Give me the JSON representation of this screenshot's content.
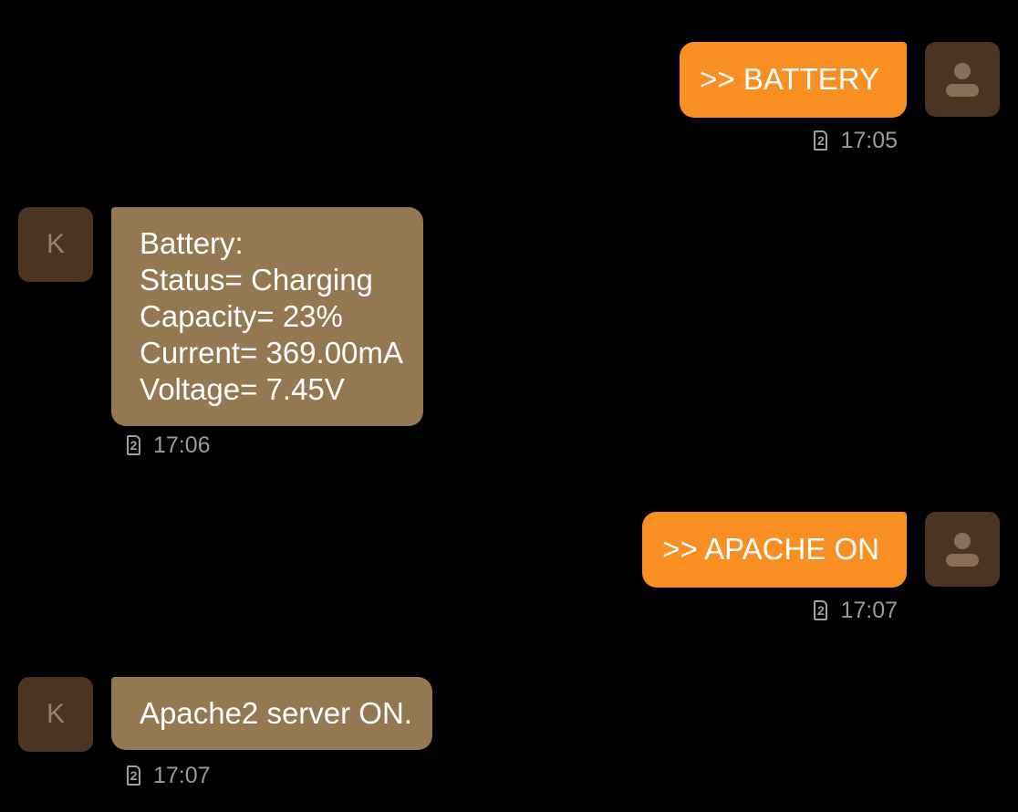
{
  "messages": [
    {
      "direction": "outgoing",
      "avatar_icon": "person-icon",
      "text": ">> BATTERY",
      "sim_slot": "2",
      "time": "17:05"
    },
    {
      "direction": "incoming",
      "avatar_letter": "K",
      "text": "Battery:\nStatus= Charging\nCapacity= 23%\nCurrent= 369.00mA\nVoltage= 7.45V",
      "sim_slot": "2",
      "time": "17:06"
    },
    {
      "direction": "outgoing",
      "avatar_icon": "person-icon",
      "text": ">> APACHE ON",
      "sim_slot": "2",
      "time": "17:07"
    },
    {
      "direction": "incoming",
      "avatar_letter": "K",
      "text": "Apache2 server ON.",
      "sim_slot": "2",
      "time": "17:07"
    }
  ],
  "colors": {
    "background": "#000000",
    "outgoing_bubble": "#f98f22",
    "incoming_bubble": "#937852",
    "avatar_bg": "#4b3522",
    "meta_text": "#9a9a9a"
  }
}
